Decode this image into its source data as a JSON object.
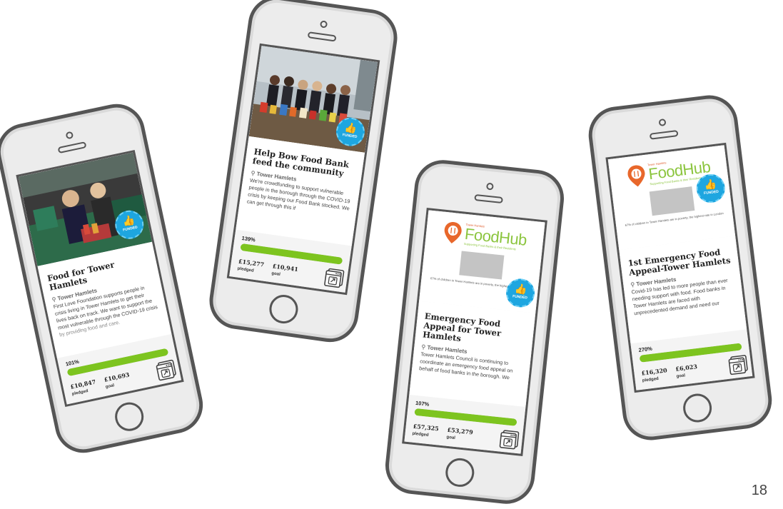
{
  "cards": [
    {
      "title": "Food for Tower Hamlets",
      "location": "Tower Hamlets",
      "description": "First Love Foundation supports people in crisis living in Tower Hamlets to get their lives back on track. We want to support the most vulnerable through the COVID-19 crisis by providing food and care.",
      "percent": "101%",
      "progress": 1.0,
      "pledged": "£10,847",
      "pledged_label": "pledged",
      "goal": "£10,693",
      "goal_label": "goal",
      "badge": "FUNDED"
    },
    {
      "title": "Help Bow Food Bank feed the community",
      "location": "Tower Hamlets",
      "description": "We're crowdfunding to support vulnerable people in the borough through the COVID-19 crisis by keeping our Food Bank stocked. We can get through this if",
      "percent": "139%",
      "progress": 1.0,
      "pledged": "£15,277",
      "pledged_label": "pledged",
      "goal": "£10,941",
      "goal_label": "goal",
      "badge": "FUNDED"
    },
    {
      "title": "Emergency Food Appeal for Tower Hamlets",
      "location": "Tower Hamlets",
      "description": "Tower Hamlets Council is continuing to coordinate an emergency food appeal on behalf of food banks in the borough. We",
      "percent": "107%",
      "progress": 1.0,
      "pledged": "£57,325",
      "pledged_label": "pledged",
      "goal": "£53,279",
      "goal_label": "goal",
      "badge": "FUNDED",
      "logo": {
        "top": "Tower Hamlets",
        "name": "FoodHub",
        "tagline": "Supporting Food Banks & their Residents",
        "caption": "67% of children in Tower Hamlets are in poverty, the highest rate in London"
      }
    },
    {
      "title": "1st Emergency Food Appeal-Tower Hamlets",
      "location": "Tower Hamlets",
      "description": "Covid-19 has led to more people than ever needing support with food. Food banks in Tower Hamlets are faced with unprecedented demand and need our",
      "percent": "270%",
      "progress": 1.0,
      "pledged": "£16,320",
      "pledged_label": "pledged",
      "goal": "£6,023",
      "goal_label": "goal",
      "badge": "FUNDED",
      "logo": {
        "top": "Tower Hamlets",
        "name": "FoodHub",
        "tagline": "Supporting Food Banks & their Residents",
        "caption": "67% of children in Tower Hamlets are in poverty, the highest rate in London"
      }
    }
  ],
  "page_number": "18",
  "colors": {
    "progress": "#7dc41f",
    "badge": "#1ea6e0",
    "foodhub_green": "#8cc53f",
    "foodhub_orange": "#e8672b",
    "phone_outline": "#555555"
  },
  "icons": {
    "location": "map-pin-icon",
    "badge": "thumbs-up-icon",
    "extension": "browser-window-icon"
  }
}
